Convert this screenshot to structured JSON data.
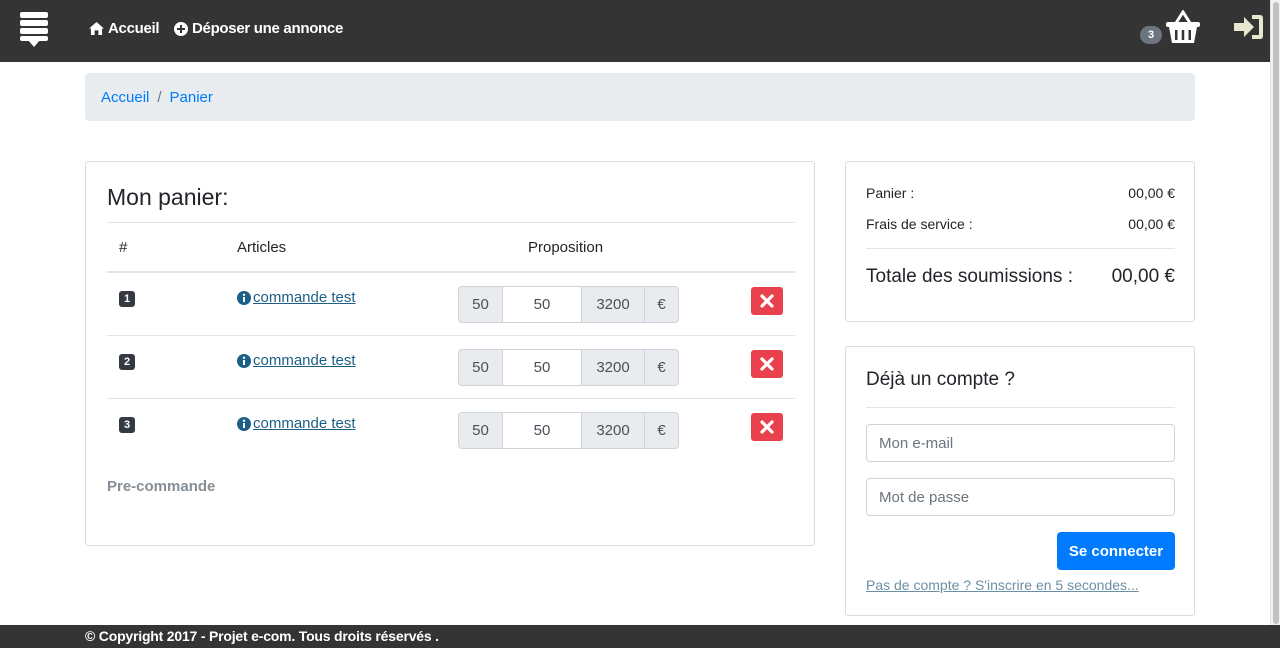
{
  "nav": {
    "home_label": "Accueil",
    "post_ad_label": "Déposer une annonce",
    "cart_count": "3"
  },
  "breadcrumb": {
    "items": [
      "Accueil",
      "Panier"
    ],
    "separator": "/"
  },
  "cart": {
    "title": "Mon panier:",
    "headers": {
      "num": "#",
      "articles": "Articles",
      "proposition": "Proposition"
    },
    "rows": [
      {
        "num": "1",
        "article": "commande test",
        "qty": "50",
        "offer": "50",
        "price": "3200",
        "currency": "€"
      },
      {
        "num": "2",
        "article": "commande test",
        "qty": "50",
        "offer": "50",
        "price": "3200",
        "currency": "€"
      },
      {
        "num": "3",
        "article": "commande test",
        "qty": "50",
        "offer": "50",
        "price": "3200",
        "currency": "€"
      }
    ],
    "precommande_label": "Pre-commande"
  },
  "summary": {
    "panier_label": "Panier :",
    "panier_value": "00,00 €",
    "frais_label": "Frais de service :",
    "frais_value": "00,00 €",
    "total_label": "Totale des soumissions :",
    "total_value": "00,00 €"
  },
  "login": {
    "title": "Déjà un compte ?",
    "email_placeholder": "Mon e-mail",
    "password_placeholder": "Mot de passe",
    "submit_label": "Se connecter",
    "signup_label": "Pas de compte ? S'inscrire en 5 secondes..."
  },
  "footer": {
    "text": "© Copyright 2017 - Projet e-com. Tous droits réservés ."
  },
  "colors": {
    "navbar": "#343434",
    "primary": "#007bff",
    "danger": "#e8404c",
    "badge": "#6c757d"
  }
}
